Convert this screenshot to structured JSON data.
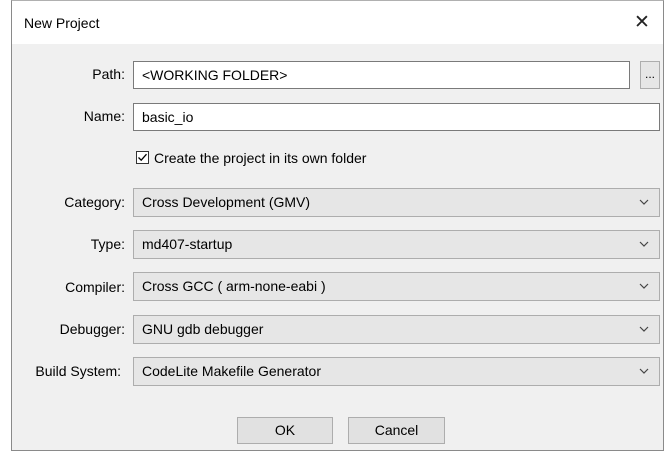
{
  "dialog": {
    "title": "New Project",
    "close_glyph": "✕"
  },
  "path": {
    "label": "Path:",
    "value": "<WORKING FOLDER>",
    "browse_label": "..."
  },
  "name": {
    "label": "Name:",
    "value": "basic_io"
  },
  "own_folder": {
    "label": "Create the project in its own folder",
    "checked": true
  },
  "category": {
    "label": "Category:",
    "value": "Cross Development (GMV)"
  },
  "type": {
    "label": "Type:",
    "value": "md407-startup"
  },
  "compiler": {
    "label": "Compiler:",
    "value": "Cross GCC ( arm-none-eabi )"
  },
  "debugger": {
    "label": "Debugger:",
    "value": "GNU gdb debugger"
  },
  "build_system": {
    "label": "Build System:",
    "value": "CodeLite Makefile Generator"
  },
  "buttons": {
    "ok": "OK",
    "cancel": "Cancel"
  },
  "icons": {
    "close": "close-icon",
    "dropdown": "chevron-down-icon",
    "check": "checkmark-icon"
  }
}
